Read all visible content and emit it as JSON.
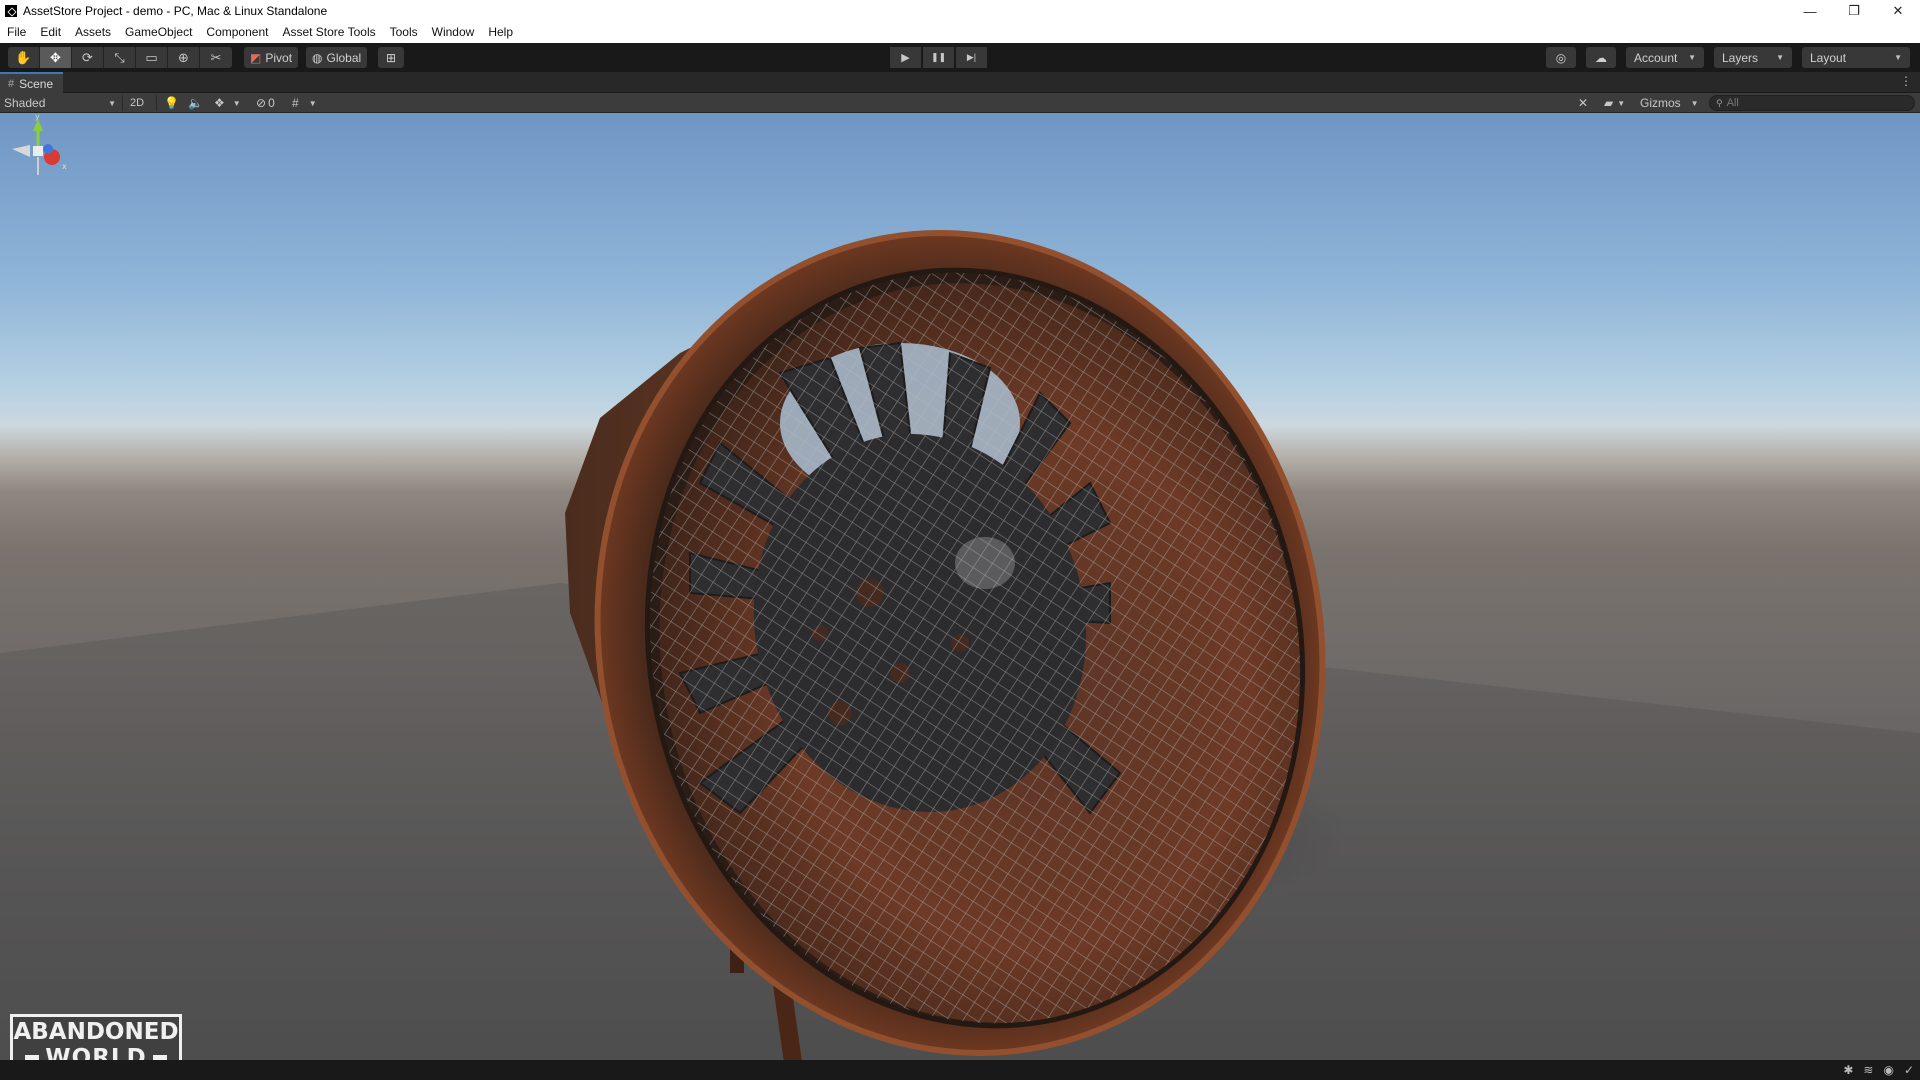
{
  "window": {
    "title": "AssetStore Project - demo - PC, Mac & Linux Standalone",
    "controls": {
      "minimize": "—",
      "restore": "❐",
      "close": "✕"
    }
  },
  "menu": [
    "File",
    "Edit",
    "Assets",
    "GameObject",
    "Component",
    "Asset Store Tools",
    "Tools",
    "Window",
    "Help"
  ],
  "toolbar": {
    "tools": [
      {
        "name": "hand-tool",
        "glyph": "✋"
      },
      {
        "name": "move-tool",
        "glyph": "✥"
      },
      {
        "name": "rotate-tool",
        "glyph": "⟳"
      },
      {
        "name": "scale-tool",
        "glyph": "⤡"
      },
      {
        "name": "rect-tool",
        "glyph": "▭"
      },
      {
        "name": "transform-tool",
        "glyph": "⊕"
      },
      {
        "name": "custom-tool",
        "glyph": "✂"
      }
    ],
    "pivot_label": "Pivot",
    "global_label": "Global",
    "snap_glyph": "⊞",
    "play_glyph": "▶",
    "pause_glyph": "❚❚",
    "step_glyph": "▶|",
    "collab_glyph": "◎",
    "cloud_glyph": "☁",
    "account_label": "Account",
    "layers_label": "Layers",
    "layout_label": "Layout"
  },
  "scene": {
    "tab_label": "Scene",
    "tab_glyph": "#",
    "kebab": "⋮",
    "shading_mode": "Shaded",
    "mode_2d": "2D",
    "hidden_count": "0",
    "gizmos_label": "Gizmos",
    "search_placeholder": "All"
  },
  "gizmo_axes": {
    "y": "y",
    "x": "x"
  },
  "logo": {
    "line1": "ABANDONED",
    "line2": "WORLD"
  },
  "colors": {
    "accent": "#3a79bb",
    "rust": "#7a3e24",
    "toolbar_bg": "#191919",
    "panel_bg": "#3c3c3c"
  }
}
